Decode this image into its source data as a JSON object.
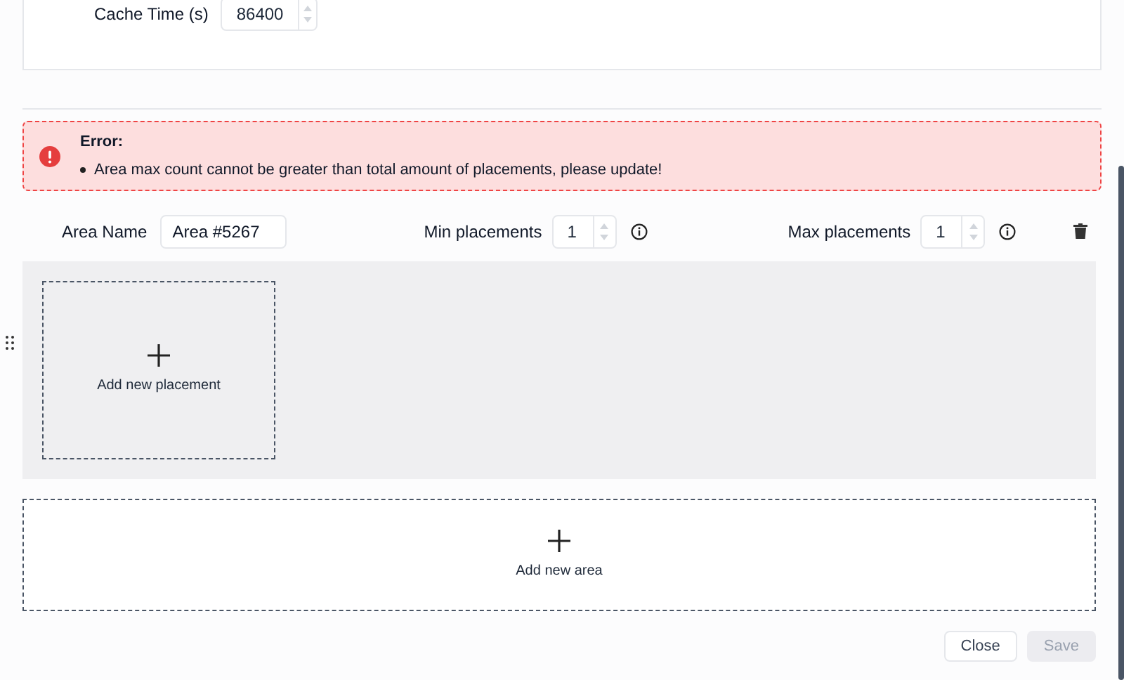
{
  "cache_time": {
    "label": "Cache Time (s)",
    "value": "86400"
  },
  "error": {
    "title": "Error:",
    "messages": [
      "Area max count cannot be greater than total amount of placements, please update!"
    ]
  },
  "area": {
    "name_label": "Area Name",
    "name_value": "Area #5267",
    "min_label": "Min placements",
    "min_value": "1",
    "max_label": "Max placements",
    "max_value": "1",
    "placements": [
      {
        "kind": "add",
        "label": "Add new placement"
      }
    ]
  },
  "add_area": {
    "label": "Add new area"
  },
  "buttons": [
    {
      "label": "Close",
      "disabled": false
    },
    {
      "label": "Save",
      "disabled": true
    }
  ]
}
